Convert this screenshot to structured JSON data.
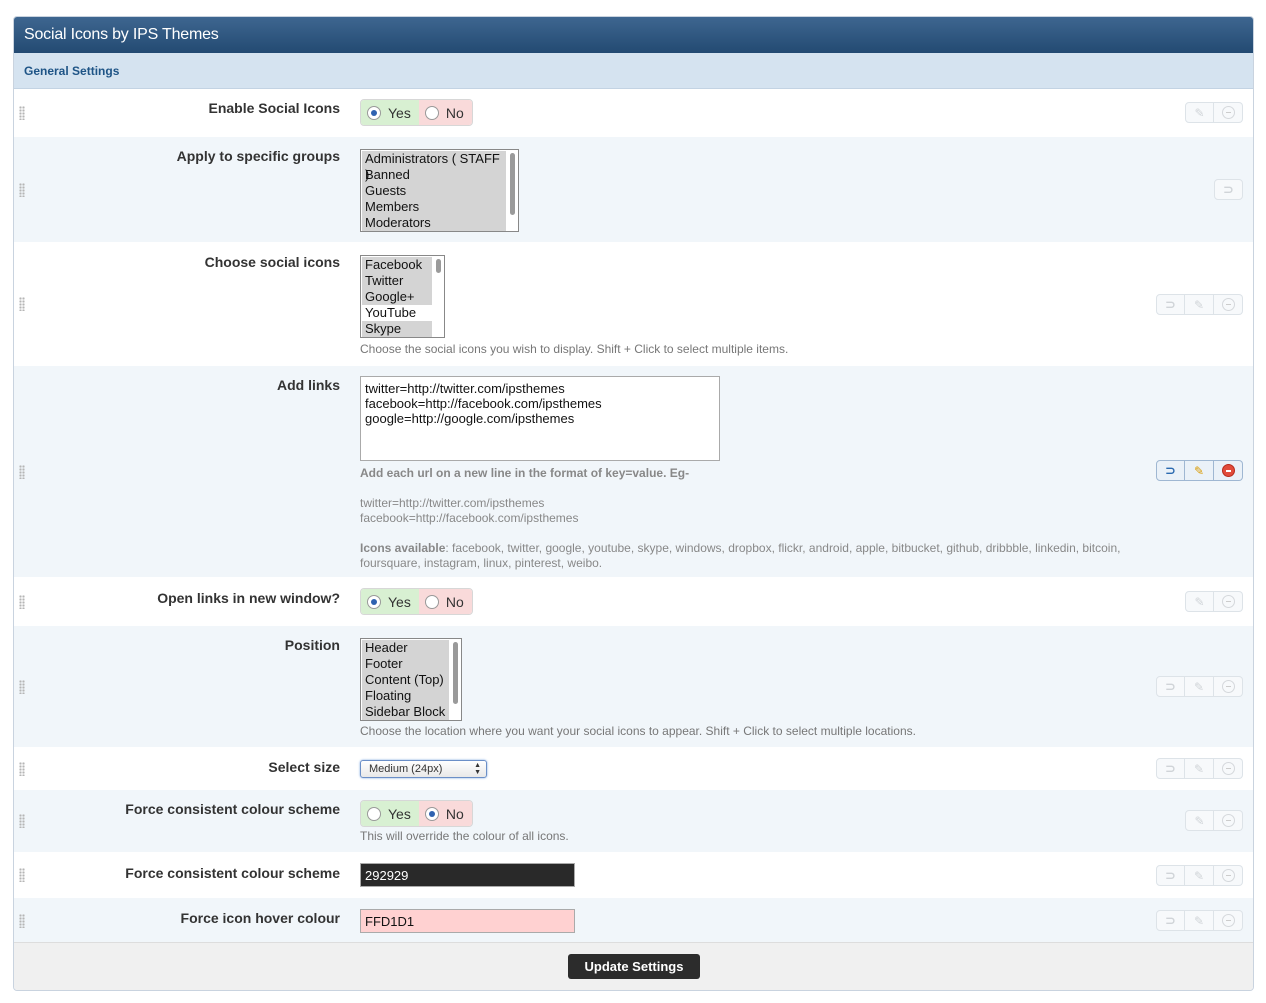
{
  "title": "Social Icons by IPS Themes",
  "section": "General Settings",
  "settings": {
    "enable": {
      "label": "Enable Social Icons",
      "yes": "Yes",
      "no": "No",
      "value": "Yes"
    },
    "groups": {
      "label": "Apply to specific groups",
      "options": [
        "Administrators ( STAFF )",
        "Banned",
        "Guests",
        "Members",
        "Moderators"
      ],
      "selected": [
        "Administrators ( STAFF )",
        "Banned",
        "Guests",
        "Members",
        "Moderators"
      ]
    },
    "icons": {
      "label": "Choose social icons",
      "options": [
        "Facebook",
        "Twitter",
        "Google+",
        "YouTube",
        "Skype"
      ],
      "selected": [
        "Facebook",
        "Twitter",
        "Google+",
        "Skype"
      ],
      "description": "Choose the social icons you wish to display. Shift + Click to select multiple items."
    },
    "links": {
      "label": "Add links",
      "lines": [
        "twitter=http://twitter.com/ipsthemes",
        "facebook=http://facebook.com/ipsthemes",
        "google=http://google.com/ipsthemes"
      ],
      "help_title": "Add each url on a new line in the format of key=value. Eg-",
      "example_1": "twitter=http://twitter.com/ipsthemes",
      "example_2": "facebook=http://facebook.com/ipsthemes",
      "available_label": "Icons available",
      "available_1": ": facebook, twitter, google, youtube, skype, windows, dropbox, flickr, android, apple, bitbucket, github, dribbble, linkedin, bitcoin,",
      "available_2": "foursquare, instagram, linux, pinterest, weibo."
    },
    "new_window": {
      "label": "Open links in new window?",
      "yes": "Yes",
      "no": "No",
      "value": "Yes"
    },
    "position": {
      "label": "Position",
      "options": [
        "Header",
        "Footer",
        "Content (Top)",
        "Floating",
        "Sidebar Block"
      ],
      "selected": [
        "Header",
        "Footer",
        "Content (Top)",
        "Floating",
        "Sidebar Block"
      ],
      "description": "Choose the location where you want your social icons to appear. Shift + Click to select multiple locations."
    },
    "size": {
      "label": "Select size",
      "value": "Medium (24px)"
    },
    "force_scheme": {
      "label": "Force consistent colour scheme",
      "yes": "Yes",
      "no": "No",
      "value": "No",
      "description": "This will override the colour of all icons."
    },
    "scheme_colour": {
      "label": "Force consistent colour scheme",
      "value": "292929",
      "color": "#292929"
    },
    "hover_colour": {
      "label": "Force icon hover colour",
      "value": "FFD1D1",
      "color": "#FFD1D1"
    }
  },
  "footer": {
    "update": "Update Settings"
  },
  "icons_meta": {
    "revert": "revert-icon",
    "edit": "pencil-icon",
    "delete": "minus-circle-icon"
  }
}
